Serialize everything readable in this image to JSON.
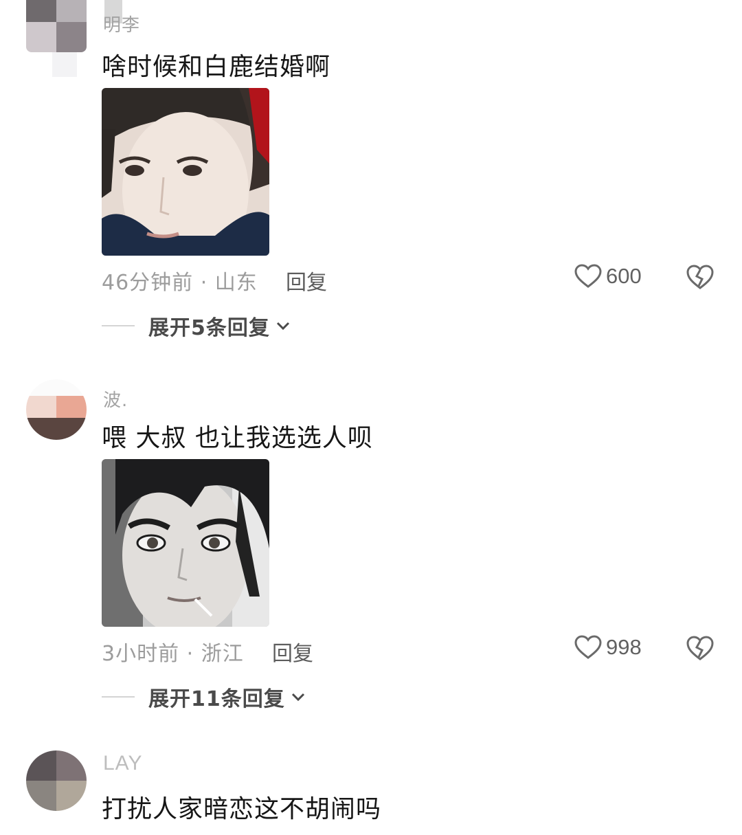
{
  "comments": [
    {
      "username": "明李",
      "text": "啥时候和白鹿结婚啊",
      "time_location": "46分钟前 · 山东",
      "reply_label": "回复",
      "likes": "600",
      "expand_label": "展开5条回复",
      "photo": "photo-of-young-man"
    },
    {
      "username": "波.",
      "text": "喂 大叔 也让我选选人呗",
      "time_location": "3小时前 · 浙江",
      "reply_label": "回复",
      "likes": "998",
      "expand_label": "展开11条回复",
      "photo": "animated-character-portrait"
    },
    {
      "username": "LAY",
      "text": "打扰人家暗恋这不胡闹吗"
    }
  ]
}
